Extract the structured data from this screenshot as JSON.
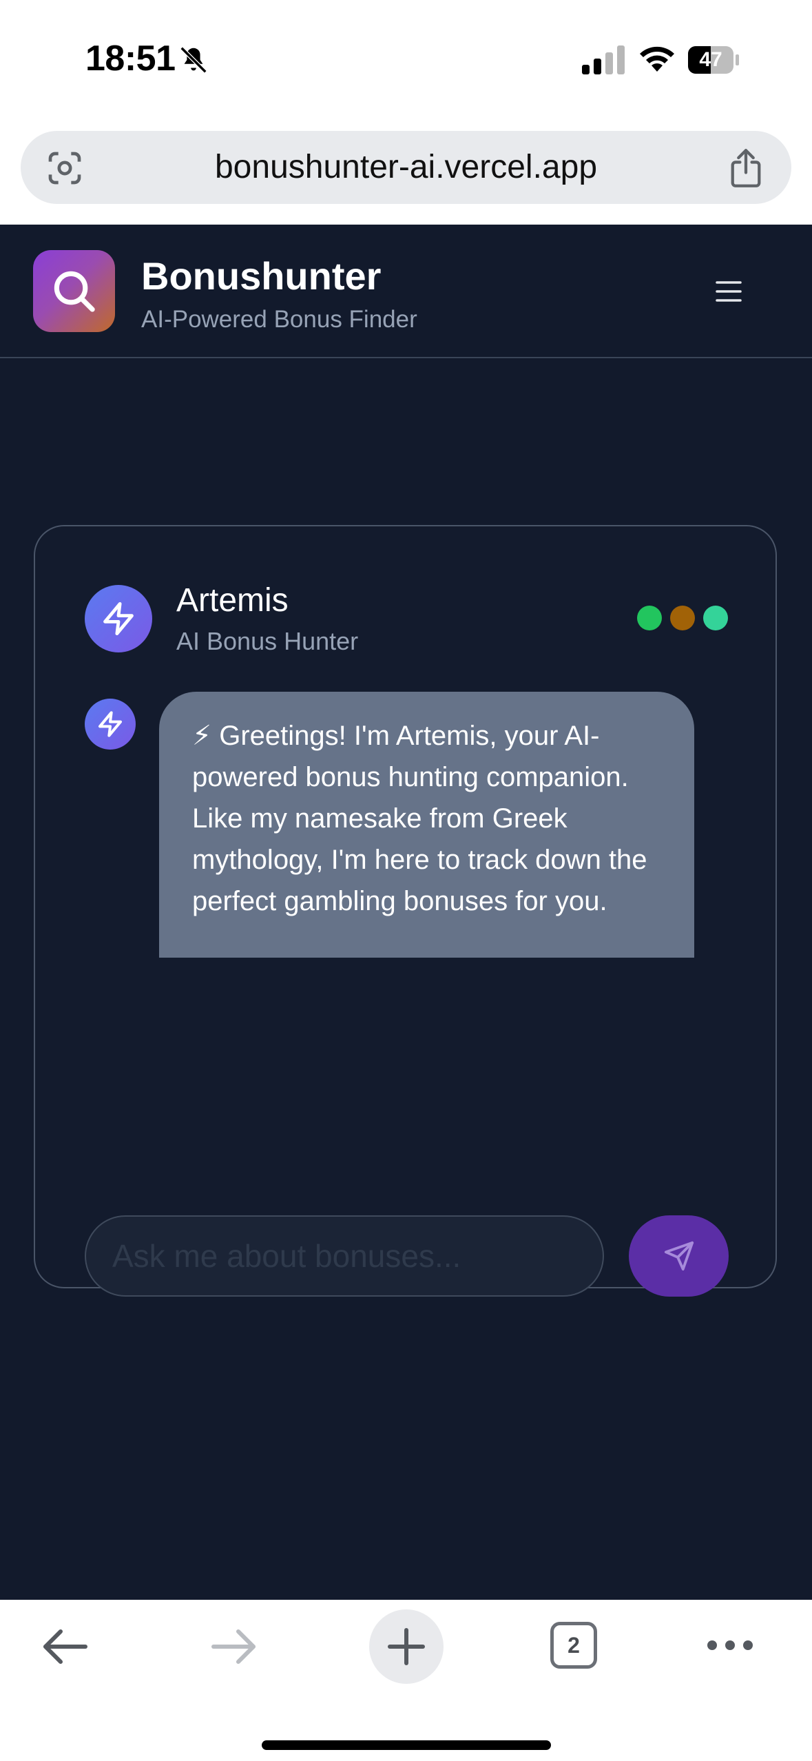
{
  "status_bar": {
    "time": "18:51",
    "battery_level": "47",
    "icons": [
      "bell-slash-icon",
      "cellular-signal-icon",
      "wifi-icon",
      "battery-icon"
    ]
  },
  "browser": {
    "url": "bonushunter-ai.vercel.app",
    "open_tabs": "2"
  },
  "header": {
    "title": "Bonushunter",
    "subtitle": "AI-Powered Bonus Finder"
  },
  "chat": {
    "agent_name": "Artemis",
    "agent_role": "AI Bonus Hunter",
    "status_dot_colors": [
      "#22c55e",
      "#a16207",
      "#34d399"
    ],
    "messages": [
      {
        "sender": "assistant",
        "text": "⚡ Greetings! I'm Artemis, your AI-powered bonus hunting companion. Like my namesake from Greek mythology, I'm here to track down the perfect gambling bonuses for you.\n\nTell me about your budget, location, and preferred games - I'll use advanced mathematical"
      }
    ],
    "input_placeholder": "Ask me about bonuses..."
  },
  "colors": {
    "app_background": "#121a2c",
    "bubble_background": "#667389",
    "send_button": "#5b2ea6",
    "logo_gradient_start": "#8a3fd6",
    "logo_gradient_end": "#c06a2a"
  }
}
